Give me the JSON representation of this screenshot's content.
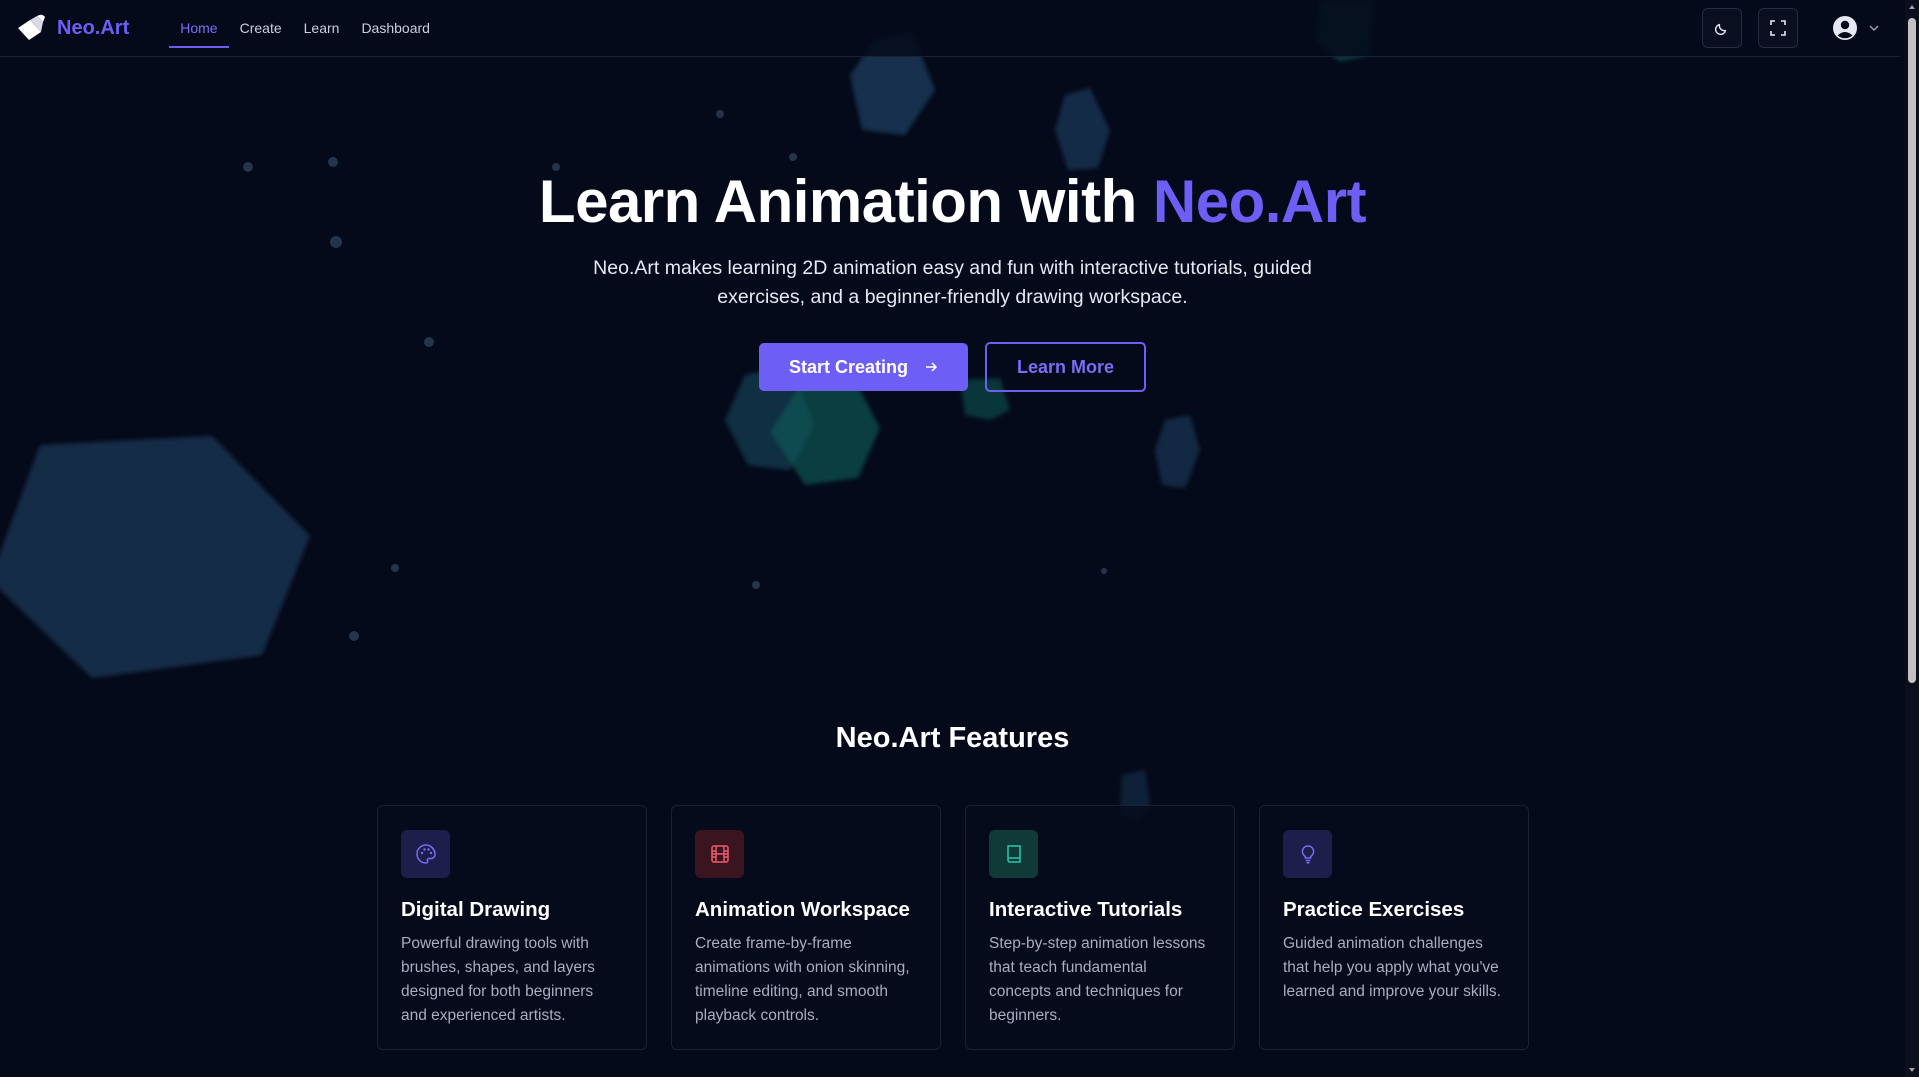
{
  "brand": {
    "name": "Neo.Art"
  },
  "nav": {
    "links": [
      {
        "label": "Home",
        "active": true
      },
      {
        "label": "Create",
        "active": false
      },
      {
        "label": "Learn",
        "active": false
      },
      {
        "label": "Dashboard",
        "active": false
      }
    ],
    "icons": [
      "moon-icon",
      "fullscreen-icon",
      "user-avatar-icon",
      "chevron-down-icon"
    ]
  },
  "hero": {
    "title_main": "Learn Animation with ",
    "title_accent": "Neo.Art",
    "subtitle": "Neo.Art makes learning 2D animation easy and fun with interactive tutorials, guided exercises, and a beginner-friendly drawing workspace.",
    "primary_button": "Start Creating",
    "secondary_button": "Learn More"
  },
  "features": {
    "title": "Neo.Art Features",
    "cards": [
      {
        "icon": "palette-icon",
        "title": "Digital Drawing",
        "description": "Powerful drawing tools with brushes, shapes, and layers designed for both beginners and experienced artists."
      },
      {
        "icon": "film-icon",
        "title": "Animation Workspace",
        "description": "Create frame-by-frame animations with onion skinning, timeline editing, and smooth playback controls."
      },
      {
        "icon": "book-icon",
        "title": "Interactive Tutorials",
        "description": "Step-by-step animation lessons that teach fundamental concepts and techniques for beginners."
      },
      {
        "icon": "lightbulb-icon",
        "title": "Practice Exercises",
        "description": "Guided animation challenges that help you apply what you've learned and improve your skills."
      }
    ]
  },
  "colors": {
    "background": "#050a1a",
    "accent": "#6d5ff5",
    "hexagon_blue": "#1b3a5a",
    "hexagon_teal": "#0f5a57",
    "card_icon_palette_bg": "#1e1e4a",
    "card_icon_film_bg": "#3a1520",
    "card_icon_book_bg": "#0f3a38",
    "card_icon_bulb_bg": "#1e1e4a"
  }
}
